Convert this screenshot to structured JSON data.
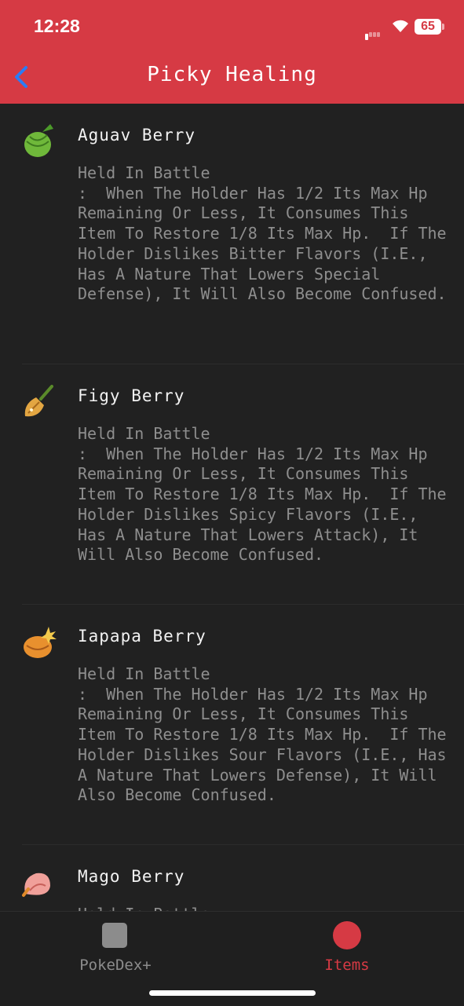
{
  "status_bar": {
    "time": "12:28",
    "battery": "65"
  },
  "nav": {
    "title": "Picky Healing"
  },
  "items": [
    {
      "name": "Aguav Berry",
      "category": "Held In Battle",
      "effect": ":  When The Holder Has 1/2 Its Max Hp Remaining Or Less, It Consumes This Item To Restore 1/8 Its Max Hp.  If The Holder Dislikes Bitter Flavors (I.E., Has A Nature That Lowers Special Defense), It Will Also Become Confused.",
      "icon": "aguav-berry-icon",
      "color": "#6fb83a"
    },
    {
      "name": "Figy Berry",
      "category": "Held In Battle",
      "effect": ":  When The Holder Has 1/2 Its Max Hp Remaining Or Less, It Consumes This Item To Restore 1/8 Its Max Hp.  If The Holder Dislikes Spicy Flavors (I.E., Has A Nature That Lowers Attack), It Will Also Become Confused.",
      "icon": "figy-berry-icon",
      "color": "#e3a642"
    },
    {
      "name": "Iapapa Berry",
      "category": "Held In Battle",
      "effect": ":  When The Holder Has 1/2 Its Max Hp Remaining Or Less, It Consumes This Item To Restore 1/8 Its Max Hp.  If The Holder Dislikes Sour Flavors (I.E., Has A Nature That Lowers Defense), It Will Also Become Confused.",
      "icon": "iapapa-berry-icon",
      "color": "#e8902e"
    },
    {
      "name": "Mago Berry",
      "category": "Held In Battle",
      "icon": "mago-berry-icon",
      "color": "#f0a09a"
    }
  ],
  "tabs": [
    {
      "label": "PokeDex+",
      "icon": "pokedex-tab-icon"
    },
    {
      "label": "Items",
      "icon": "items-tab-icon",
      "active": true
    }
  ],
  "colors": {
    "accent": "#d63a44",
    "background": "#212121"
  }
}
